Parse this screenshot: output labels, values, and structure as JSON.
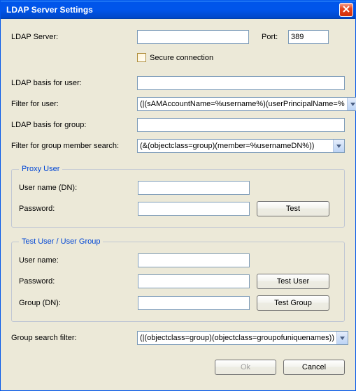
{
  "title": "LDAP Server Settings",
  "labels": {
    "ldap_server": "LDAP Server:",
    "port": "Port:",
    "secure_connection": "Secure connection",
    "ldap_basis_user": "LDAP basis for user:",
    "filter_user": "Filter for user:",
    "ldap_basis_group": "LDAP basis for group:",
    "filter_group_member": "Filter for group member search:",
    "group_search_filter": "Group search filter:"
  },
  "values": {
    "ldap_server": "",
    "port": "389",
    "secure_connection": false,
    "ldap_basis_user": "",
    "filter_user": "(|(sAMAccountName=%username%)(userPrincipalName=%",
    "ldap_basis_group": "",
    "filter_group_member": "(&(objectclass=group)(member=%usernameDN%))",
    "group_search_filter": "(|(objectclass=group)(objectclass=groupofuniquenames))"
  },
  "proxy_user": {
    "legend": "Proxy User",
    "username_label": "User name (DN):",
    "password_label": "Password:",
    "username_value": "",
    "password_value": "",
    "test_label": "Test"
  },
  "test_user": {
    "legend": "Test User / User Group",
    "username_label": "User name:",
    "password_label": "Password:",
    "group_label": "Group (DN):",
    "username_value": "",
    "password_value": "",
    "group_value": "",
    "test_user_label": "Test User",
    "test_group_label": "Test Group"
  },
  "footer": {
    "ok": "Ok",
    "cancel": "Cancel"
  }
}
